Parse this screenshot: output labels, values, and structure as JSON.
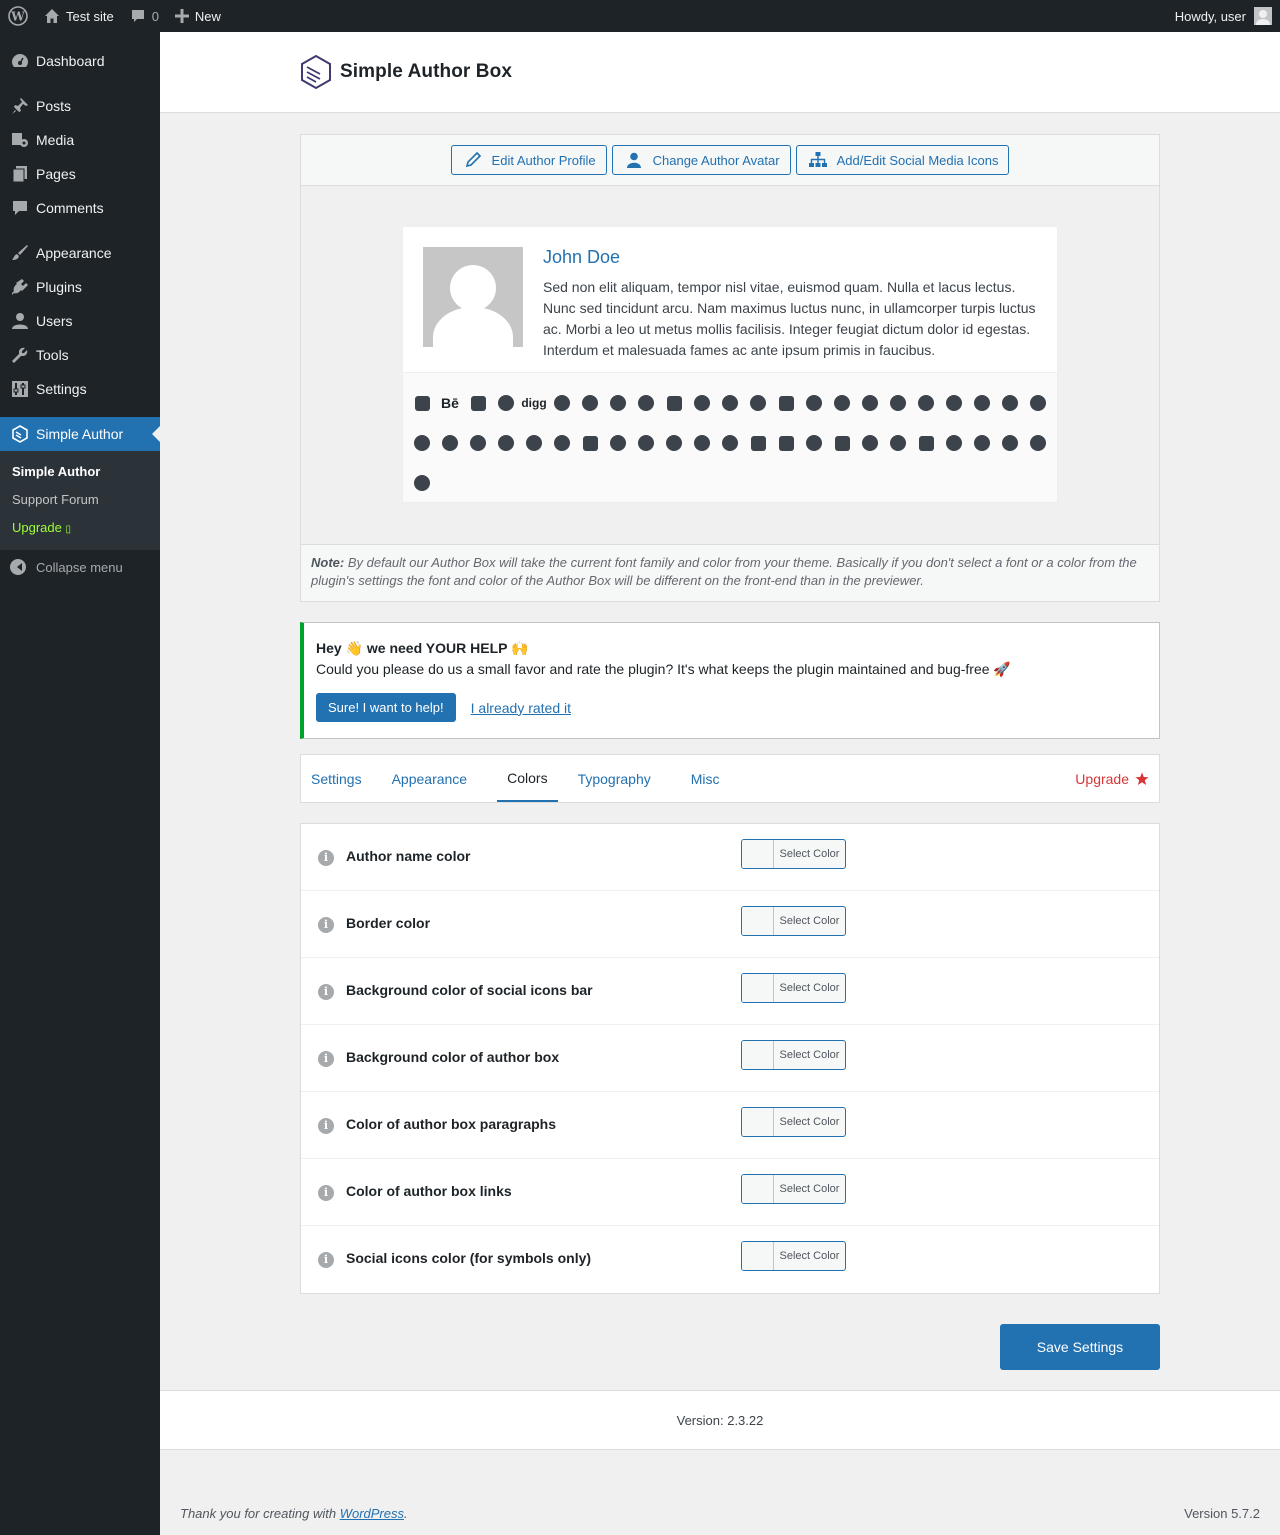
{
  "adminbar": {
    "site_name": "Test site",
    "comments_count": "0",
    "new_label": "New",
    "howdy": "Howdy, user"
  },
  "sidebar": {
    "items": [
      {
        "label": "Dashboard",
        "icon": "dashboard-icon"
      },
      {
        "label": "Posts",
        "icon": "pin-icon"
      },
      {
        "label": "Media",
        "icon": "media-icon"
      },
      {
        "label": "Pages",
        "icon": "pages-icon"
      },
      {
        "label": "Comments",
        "icon": "comment-icon"
      },
      {
        "label": "Appearance",
        "icon": "brush-icon"
      },
      {
        "label": "Plugins",
        "icon": "plug-icon"
      },
      {
        "label": "Users",
        "icon": "user-icon"
      },
      {
        "label": "Tools",
        "icon": "wrench-icon"
      },
      {
        "label": "Settings",
        "icon": "sliders-icon"
      },
      {
        "label": "Simple Author",
        "icon": "box-icon"
      }
    ],
    "submenu": [
      "Simple Author",
      "Support Forum",
      "Upgrade"
    ],
    "collapse": "Collapse menu"
  },
  "header": {
    "logo_text": "Simple Author Box"
  },
  "toolbar": {
    "edit_profile": "Edit Author Profile",
    "change_avatar": "Change Author Avatar",
    "social_icons": "Add/Edit Social Media Icons"
  },
  "author_box": {
    "name": "John Doe",
    "bio": "Sed non elit aliquam, tempor nisl vitae, euismod quam. Nulla et lacus lectus. Nunc sed tincidunt arcu. Nam maximus luctus nunc, in ullamcorper turpis luctus ac. Morbi a leo ut metus mollis facilisis. Integer feugiat dictum dolor id egestas. Interdum et malesuada fames ac ante ipsum primis in faucibus.",
    "behance_text": "Bē",
    "digg_text": "digg",
    "social_icons": [
      "addthis-icon",
      "behance-icon",
      "delicious-icon",
      "deviantart-icon",
      "digg-icon",
      "discord-icon",
      "dribbble-icon",
      "facebook-icon",
      "whatsapp-icon",
      "flickr-icon",
      "github-icon",
      "google-icon",
      "googleplus-icon",
      "html5-icon",
      "instagram-icon",
      "linkedin-icon",
      "pinterest-icon",
      "reddit-icon",
      "rss-icon",
      "share-icon",
      "skype-icon",
      "soundcloud-icon",
      "spotify-icon",
      "stackoverflow-icon",
      "steam-icon",
      "stumbleupon-icon",
      "tumblr-icon",
      "twitter-icon",
      "vimeo-icon",
      "windows-icon",
      "wordpress-icon",
      "yahoo-icon",
      "youtube-icon",
      "xing-icon",
      "mixcloud-icon",
      "goodreads-icon",
      "twitch-icon",
      "vk-icon",
      "medium-icon",
      "quora-icon",
      "meetup-icon",
      "email-icon",
      "snapchat-icon",
      "500px-icon",
      "mastodon-icon",
      "telegram-icon",
      "phone-icon"
    ]
  },
  "note": {
    "label": "Note:",
    "text": "By default our Author Box will take the current font family and color from your theme. Basically if you don't select a font or a color from the plugin's settings the font and color of the Author Box will be different on the front-end than in the previewer."
  },
  "help": {
    "title_pre": "Hey 👋 we need ",
    "title_strong": "YOUR HELP",
    "title_post": " 🙌",
    "text": "Could you please do us a small favor and rate the plugin? It's what keeps the plugin maintained and bug-free 🚀",
    "sure_button": "Sure! I want to help!",
    "rated_link": "I already rated it"
  },
  "tabs": {
    "items": [
      "Settings",
      "Appearance",
      "Colors",
      "Typography",
      "Misc"
    ],
    "active": "Colors",
    "upgrade": "Upgrade"
  },
  "color_settings": [
    {
      "label": "Author name color",
      "button": "Select Color"
    },
    {
      "label": "Border color",
      "button": "Select Color"
    },
    {
      "label": "Background color of social icons bar",
      "button": "Select Color"
    },
    {
      "label": "Background color of author box",
      "button": "Select Color"
    },
    {
      "label": "Color of author box paragraphs",
      "button": "Select Color"
    },
    {
      "label": "Color of author box links",
      "button": "Select Color"
    },
    {
      "label": "Social icons color (for symbols only)",
      "button": "Select Color"
    }
  ],
  "save_button": "Save Settings",
  "version": "Version: 2.3.22",
  "footer": {
    "thanks_pre": "Thank you for creating with ",
    "wordpress_link": "WordPress",
    "thanks_post": ".",
    "wp_version": "Version 5.7.2"
  },
  "colors": {
    "accent": "#2271b1",
    "sidebar_bg": "#1d2327",
    "upgrade_green": "#9cff36",
    "upgrade_red": "#d63638",
    "success_border": "#00a32a"
  }
}
